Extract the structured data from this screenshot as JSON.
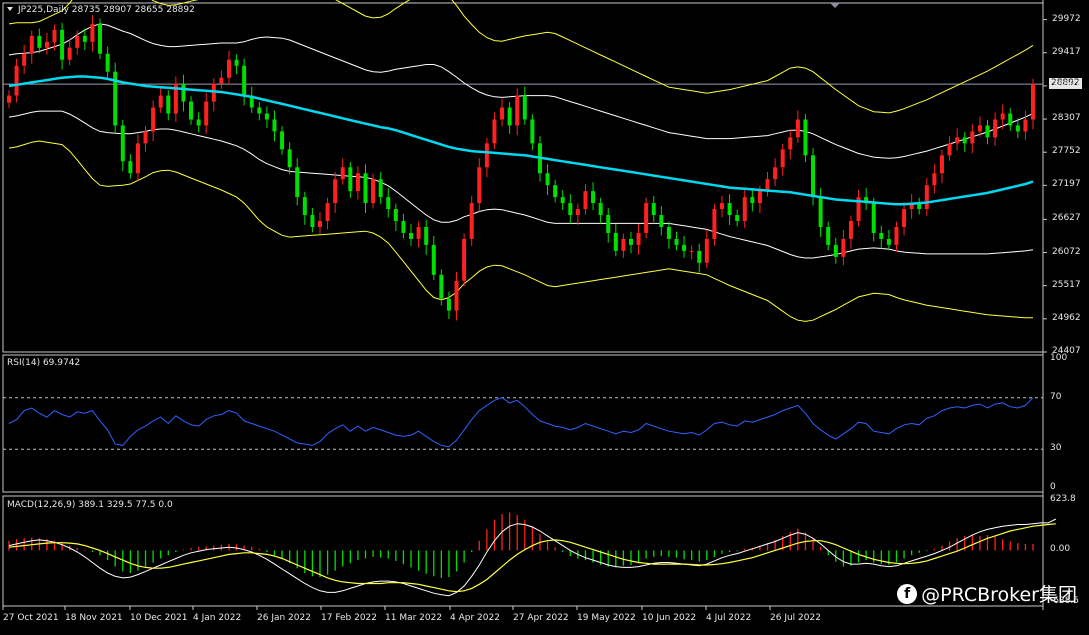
{
  "header": {
    "symbol_line": "JP225,Daily  28735 28907 28655 28892",
    "rsi_line": "RSI(14) 69.9742",
    "macd_line": "MACD(12,26,9) 389.1 329.5 77.5 0.0"
  },
  "watermark": {
    "icon": "facebook-icon",
    "text": "@PRCBroker集团"
  },
  "current_price_tag": "28892",
  "colors": {
    "bull": "#ff2020",
    "bear": "#00e000",
    "ma": "#00d8f0",
    "bb_outer": "#ffff40",
    "bb_inner": "#ffffff",
    "rsi": "#3060ff",
    "macd_signal": "#ffff40",
    "macd_main": "#ffffff"
  },
  "chart_data": [
    {
      "type": "candlestick",
      "title": "JP225,Daily",
      "ohlc_last": {
        "open": 28735,
        "high": 28907,
        "low": 28655,
        "close": 28892
      },
      "y_ticks": [
        "29972",
        "29417",
        "28862",
        "28307",
        "27752",
        "27197",
        "26627",
        "26072",
        "25517",
        "24962",
        "24407"
      ],
      "x_ticks": [
        "27 Oct 2021",
        "18 Nov 2021",
        "10 Dec 2021",
        "4 Jan 2022",
        "26 Jan 2022",
        "17 Feb 2022",
        "11 Mar 2022",
        "4 Apr 2022",
        "27 Apr 2022",
        "19 May 2022",
        "10 Jun 2022",
        "4 Jul 2022",
        "26 Jul 2022"
      ],
      "ylim": [
        24407,
        30250
      ],
      "closes": [
        28700,
        29200,
        29400,
        29700,
        29500,
        29600,
        29800,
        29300,
        29500,
        29700,
        29600,
        29900,
        29400,
        29100,
        28200,
        27600,
        27400,
        27900,
        28100,
        28500,
        28700,
        28400,
        28900,
        28600,
        28300,
        28200,
        28600,
        28900,
        29000,
        29300,
        29200,
        28700,
        28500,
        28400,
        28300,
        28100,
        27800,
        27500,
        27000,
        26700,
        26500,
        26600,
        26900,
        27300,
        27500,
        27100,
        27400,
        26900,
        27300,
        27000,
        26800,
        26600,
        26400,
        26300,
        26500,
        26200,
        25700,
        25300,
        25100,
        25600,
        26300,
        26900,
        27500,
        27900,
        28300,
        28500,
        28200,
        28700,
        28300,
        27900,
        27400,
        27200,
        27000,
        26900,
        26700,
        26800,
        27100,
        26900,
        26700,
        26400,
        26100,
        26300,
        26200,
        26400,
        26900,
        26700,
        26500,
        26300,
        26200,
        26100,
        26100,
        25900,
        26300,
        26800,
        26900,
        26700,
        26600,
        27000,
        26900,
        27100,
        27300,
        27500,
        27800,
        28000,
        28300,
        27700,
        27000,
        26500,
        26200,
        26000,
        26300,
        26600,
        27000,
        26900,
        26400,
        26300,
        26200,
        26500,
        26800,
        26900,
        26800,
        27200,
        27400,
        27700,
        27900,
        28000,
        27900,
        28100,
        28200,
        28000,
        28300,
        28400,
        28200,
        28100,
        28300,
        28892
      ],
      "ma_line": [
        28860,
        28880,
        28900,
        28920,
        28940,
        28960,
        28980,
        29000,
        29010,
        29020,
        29020,
        29010,
        29000,
        28980,
        28950,
        28920,
        28900,
        28880,
        28860,
        28850,
        28840,
        28830,
        28820,
        28810,
        28800,
        28790,
        28780,
        28770,
        28760,
        28740,
        28720,
        28700,
        28680,
        28650,
        28620,
        28590,
        28560,
        28530,
        28500,
        28470,
        28440,
        28410,
        28380,
        28350,
        28320,
        28290,
        28260,
        28230,
        28200,
        28170,
        28150,
        28120,
        28080,
        28040,
        28000,
        27960,
        27920,
        27880,
        27840,
        27810,
        27790,
        27770,
        27760,
        27750,
        27740,
        27730,
        27720,
        27710,
        27700,
        27680,
        27660,
        27640,
        27620,
        27600,
        27580,
        27560,
        27540,
        27520,
        27500,
        27480,
        27460,
        27440,
        27420,
        27400,
        27380,
        27360,
        27340,
        27320,
        27300,
        27280,
        27260,
        27240,
        27220,
        27200,
        27180,
        27160,
        27150,
        27140,
        27130,
        27120,
        27110,
        27100,
        27090,
        27080,
        27060,
        27040,
        27020,
        27000,
        26980,
        26960,
        26950,
        26940,
        26930,
        26920,
        26910,
        26900,
        26890,
        26880,
        26880,
        26890,
        26900,
        26910,
        26930,
        26950,
        26970,
        26990,
        27010,
        27030,
        27050,
        27070,
        27100,
        27130,
        27160,
        27190,
        27220,
        27260
      ],
      "bb_inner_width": [
        520,
        520,
        510,
        500,
        500,
        520,
        540,
        560,
        620,
        700,
        780,
        850,
        900,
        900,
        880,
        860,
        840,
        800,
        760,
        720,
        700,
        690,
        700,
        720,
        740,
        760,
        780,
        800,
        820,
        840,
        860,
        900,
        960,
        1020,
        1060,
        1080,
        1100,
        1100,
        1080,
        1060,
        1040,
        1020,
        1000,
        980,
        960,
        940,
        920,
        900,
        900,
        920,
        960,
        1020,
        1080,
        1140,
        1200,
        1260,
        1300,
        1300,
        1260,
        1200,
        1120,
        1060,
        1000,
        960,
        940,
        940,
        960,
        980,
        1000,
        1020,
        1040,
        1060,
        1060,
        1040,
        1020,
        1000,
        980,
        960,
        940,
        920,
        900,
        880,
        860,
        840,
        820,
        800,
        780,
        760,
        760,
        760,
        760,
        760,
        760,
        780,
        800,
        820,
        840,
        860,
        880,
        900,
        920,
        960,
        1000,
        1040,
        1060,
        1060,
        1040,
        1000,
        960,
        920,
        880,
        840,
        800,
        780,
        760,
        760,
        760,
        780,
        800,
        820,
        840,
        860,
        880,
        900,
        920,
        940,
        960,
        980,
        1000,
        1020,
        1040,
        1060,
        1080,
        1100,
        1120,
        1140
      ],
      "bb_outer_ratio": 2,
      "highlight_line_price": 28892
    },
    {
      "type": "line",
      "title": "RSI(14) 69.9742",
      "y_ticks": [
        "100",
        "70",
        "30",
        "0"
      ],
      "ylim": [
        0,
        100
      ],
      "levels": [
        70,
        30
      ],
      "values": [
        50,
        53,
        60,
        62,
        58,
        55,
        60,
        57,
        55,
        59,
        58,
        60,
        52,
        45,
        34,
        33,
        40,
        45,
        48,
        52,
        55,
        50,
        56,
        52,
        49,
        48,
        53,
        56,
        57,
        60,
        58,
        52,
        50,
        48,
        46,
        44,
        41,
        38,
        35,
        34,
        33,
        36,
        42,
        46,
        49,
        44,
        48,
        44,
        47,
        45,
        43,
        41,
        40,
        41,
        44,
        40,
        36,
        33,
        32,
        37,
        45,
        53,
        60,
        64,
        68,
        70,
        66,
        68,
        63,
        57,
        52,
        50,
        48,
        47,
        45,
        47,
        50,
        48,
        46,
        44,
        42,
        44,
        43,
        45,
        50,
        48,
        46,
        44,
        43,
        42,
        43,
        41,
        45,
        50,
        51,
        49,
        48,
        52,
        51,
        53,
        55,
        57,
        60,
        62,
        64,
        58,
        50,
        45,
        41,
        38,
        42,
        46,
        51,
        50,
        44,
        43,
        42,
        46,
        49,
        50,
        49,
        54,
        56,
        60,
        62,
        63,
        62,
        64,
        65,
        62,
        65,
        66,
        63,
        62,
        64,
        70
      ]
    },
    {
      "type": "bar",
      "title": "MACD(12,26,9) 389.1 329.5 77.5 0.0",
      "y_ticks": [
        "623.8",
        "0.00",
        "-638.5"
      ],
      "ylim": [
        -638.5,
        623.8
      ],
      "histogram": [
        120,
        140,
        150,
        160,
        150,
        140,
        120,
        90,
        60,
        30,
        10,
        -20,
        -60,
        -120,
        -200,
        -260,
        -280,
        -250,
        -200,
        -150,
        -100,
        -60,
        -20,
        10,
        30,
        40,
        50,
        60,
        70,
        80,
        75,
        60,
        40,
        20,
        -20,
        -60,
        -100,
        -160,
        -220,
        -280,
        -320,
        -330,
        -300,
        -250,
        -200,
        -160,
        -120,
        -100,
        -80,
        -90,
        -100,
        -130,
        -170,
        -210,
        -250,
        -290,
        -320,
        -340,
        -330,
        -260,
        -150,
        -20,
        120,
        260,
        380,
        450,
        470,
        440,
        380,
        300,
        200,
        110,
        40,
        -20,
        -70,
        -100,
        -120,
        -150,
        -180,
        -200,
        -210,
        -190,
        -180,
        -160,
        -100,
        -80,
        -70,
        -80,
        -90,
        -110,
        -120,
        -140,
        -120,
        -80,
        -40,
        -20,
        -10,
        20,
        30,
        60,
        90,
        130,
        180,
        230,
        270,
        220,
        140,
        40,
        -60,
        -140,
        -200,
        -190,
        -150,
        -120,
        -150,
        -170,
        -180,
        -150,
        -100,
        -60,
        -30,
        -10,
        20,
        60,
        110,
        150,
        180,
        190,
        180,
        190,
        170,
        140,
        110,
        90,
        80,
        80
      ],
      "macd_main": [
        60,
        80,
        100,
        120,
        130,
        120,
        100,
        70,
        30,
        -20,
        -80,
        -150,
        -220,
        -280,
        -320,
        -340,
        -330,
        -300,
        -260,
        -220,
        -180,
        -140,
        -100,
        -60,
        -30,
        -10,
        10,
        20,
        30,
        40,
        30,
        10,
        -20,
        -60,
        -110,
        -170,
        -230,
        -290,
        -350,
        -410,
        -460,
        -500,
        -520,
        -520,
        -500,
        -470,
        -440,
        -410,
        -390,
        -380,
        -380,
        -390,
        -410,
        -440,
        -470,
        -500,
        -530,
        -550,
        -560,
        -520,
        -440,
        -320,
        -180,
        -20,
        120,
        230,
        300,
        330,
        320,
        290,
        240,
        180,
        120,
        60,
        0,
        -50,
        -90,
        -120,
        -150,
        -180,
        -200,
        -210,
        -210,
        -200,
        -180,
        -160,
        -150,
        -150,
        -160,
        -170,
        -180,
        -190,
        -170,
        -130,
        -90,
        -60,
        -40,
        -10,
        20,
        50,
        80,
        110,
        150,
        190,
        220,
        200,
        150,
        80,
        0,
        -80,
        -140,
        -170,
        -170,
        -160,
        -170,
        -190,
        -200,
        -190,
        -160,
        -130,
        -100,
        -70,
        -40,
        0,
        40,
        90,
        140,
        190,
        230,
        260,
        280,
        300,
        310,
        320,
        320,
        330,
        340,
        340,
        389.1
      ],
      "signal": [
        40,
        50,
        60,
        70,
        80,
        90,
        95,
        95,
        90,
        80,
        60,
        30,
        0,
        -40,
        -80,
        -120,
        -160,
        -190,
        -210,
        -220,
        -220,
        -210,
        -190,
        -170,
        -150,
        -130,
        -110,
        -90,
        -70,
        -50,
        -40,
        -30,
        -30,
        -40,
        -50,
        -70,
        -100,
        -140,
        -180,
        -220,
        -260,
        -300,
        -340,
        -370,
        -390,
        -400,
        -410,
        -410,
        -410,
        -410,
        -400,
        -400,
        -400,
        -410,
        -420,
        -440,
        -460,
        -480,
        -500,
        -510,
        -500,
        -470,
        -420,
        -360,
        -280,
        -200,
        -120,
        -50,
        10,
        60,
        100,
        120,
        130,
        120,
        100,
        70,
        40,
        10,
        -20,
        -50,
        -80,
        -110,
        -130,
        -150,
        -160,
        -170,
        -170,
        -170,
        -170,
        -170,
        -175,
        -180,
        -180,
        -175,
        -165,
        -150,
        -130,
        -110,
        -90,
        -60,
        -30,
        0,
        30,
        60,
        90,
        110,
        120,
        120,
        100,
        70,
        30,
        -10,
        -50,
        -80,
        -110,
        -130,
        -150,
        -160,
        -165,
        -160,
        -150,
        -130,
        -100,
        -70,
        -40,
        -10,
        30,
        70,
        110,
        150,
        180,
        210,
        240,
        260,
        280,
        300,
        310,
        320,
        329.5
      ]
    }
  ]
}
